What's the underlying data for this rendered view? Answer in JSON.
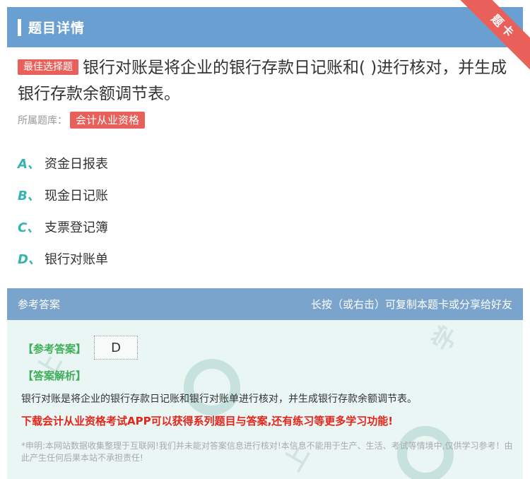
{
  "header": {
    "title": "题目详情",
    "ribbon_label": "题卡"
  },
  "question": {
    "type_tag": "最佳选择题",
    "text": "银行对账是将企业的银行存款日记账和( )进行核对，并生成银行存款余额调节表。",
    "category_label": "所属题库：",
    "category_value": "会计从业资格"
  },
  "options": [
    {
      "letter": "A、",
      "text": "资金日报表"
    },
    {
      "letter": "B、",
      "text": "现金日记账"
    },
    {
      "letter": "C、",
      "text": "支票登记簿"
    },
    {
      "letter": "D、",
      "text": "银行对账单"
    }
  ],
  "answer": {
    "section_title": "参考答案",
    "share_hint": "长按（或右击）可复制本题卡或分享给好友",
    "answer_label": "【参考答案】",
    "answer_value": "D",
    "explanation_label": "【答案解析】",
    "explanation_text": "银行对账是将企业的银行存款日记账和银行对账单进行核对，并生成银行存款余额调节表。",
    "promo_text": "下载会计从业资格考试APP可以获得系列题目与答案,还有练习等更多学习功能!",
    "disclaimer": "*申明:本网站数据收集整理于互联网!我们并未能对答案信息进行核对!本信息不能用于生产、生活、考试等情境中,仅供学习参考！由此产生任何后果本站不承担责任!"
  },
  "colors": {
    "header": "#6a9fd2",
    "accent_red": "#e9605a",
    "option_letter": "#35b3b0",
    "answer_green": "#3fae5a",
    "promo_red": "#e8231a"
  }
}
